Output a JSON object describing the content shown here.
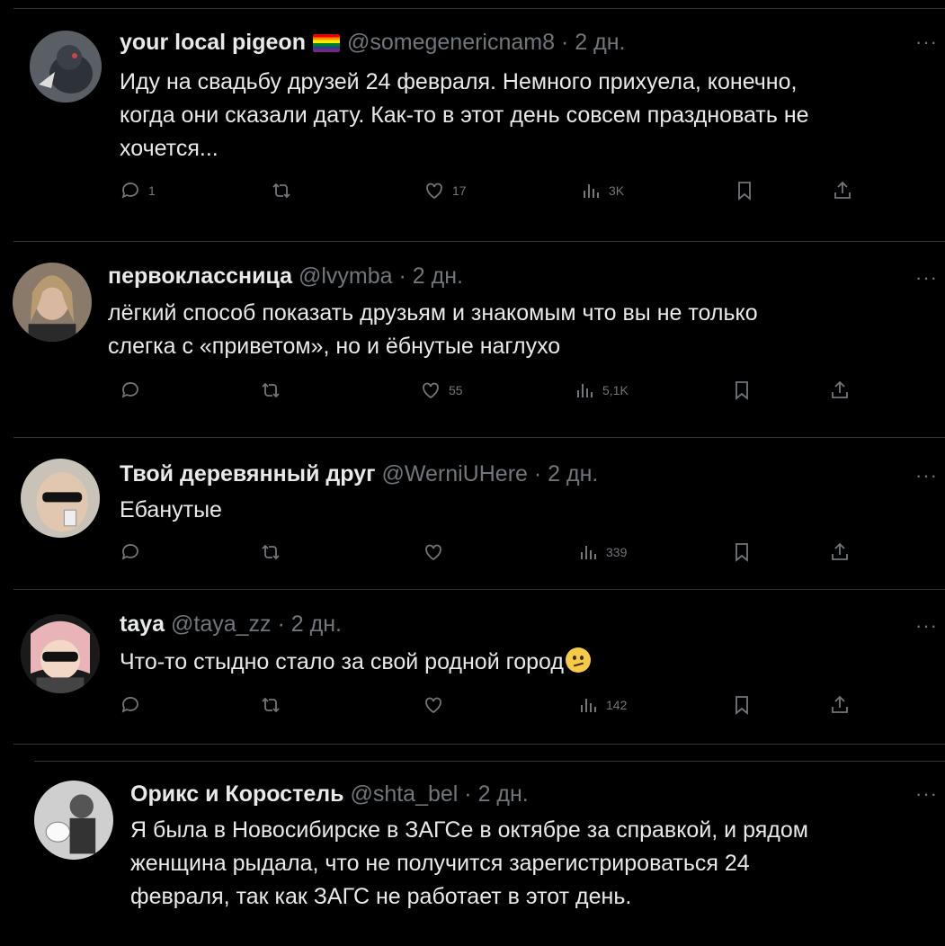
{
  "tweets": [
    {
      "name": "your local pigeon",
      "handle": "@somegenericnam8",
      "time": "· 2 дн.",
      "text": "Иду на свадьбу друзей 24 февраля. Немного прихуела, конечно,\nкогда они сказали дату. Как-то в этот день совсем праздновать не\nхочется...",
      "replies": "1",
      "retweets": "",
      "likes": "17",
      "views": "3K"
    },
    {
      "name": "первоклассница",
      "handle": "@lvymba",
      "time": "· 2 дн.",
      "text": "лёгкий способ показать друзьям и знакомым что вы не только\nслегка с «приветом», но и ёбнутые наглухо",
      "replies": "",
      "retweets": "",
      "likes": "55",
      "views": "5,1K"
    },
    {
      "name": "Твой деревянный друг",
      "handle": "@WerniUHere",
      "time": "· 2 дн.",
      "text": "Ебанутые",
      "replies": "",
      "retweets": "",
      "likes": "",
      "views": "339"
    },
    {
      "name": "taya",
      "handle": "@taya_zz",
      "time": "· 2 дн.",
      "text": "Что-то стыдно стало за свой родной город",
      "replies": "",
      "retweets": "",
      "likes": "",
      "views": "142"
    },
    {
      "name": "Орикс и Коростель",
      "handle": "@shta_bel",
      "time": "· 2 дн.",
      "text": "Я была в Новосибирске в ЗАГСе в октябре за справкой, и рядом\nженщина рыдала, что не получится зарегистрироваться 24\nфевраля, так как ЗАГС не работает в этот день."
    }
  ],
  "more_label": "···",
  "icons": [
    "reply-icon",
    "retweet-icon",
    "like-icon",
    "views-icon",
    "bookmark-icon",
    "share-icon",
    "more-icon",
    "pride-flag-icon",
    "confused-face-emoji"
  ],
  "colors": {
    "background": "#000000",
    "text": "#e7e9ea",
    "secondary": "#71767b",
    "divider": "#2f3336"
  }
}
